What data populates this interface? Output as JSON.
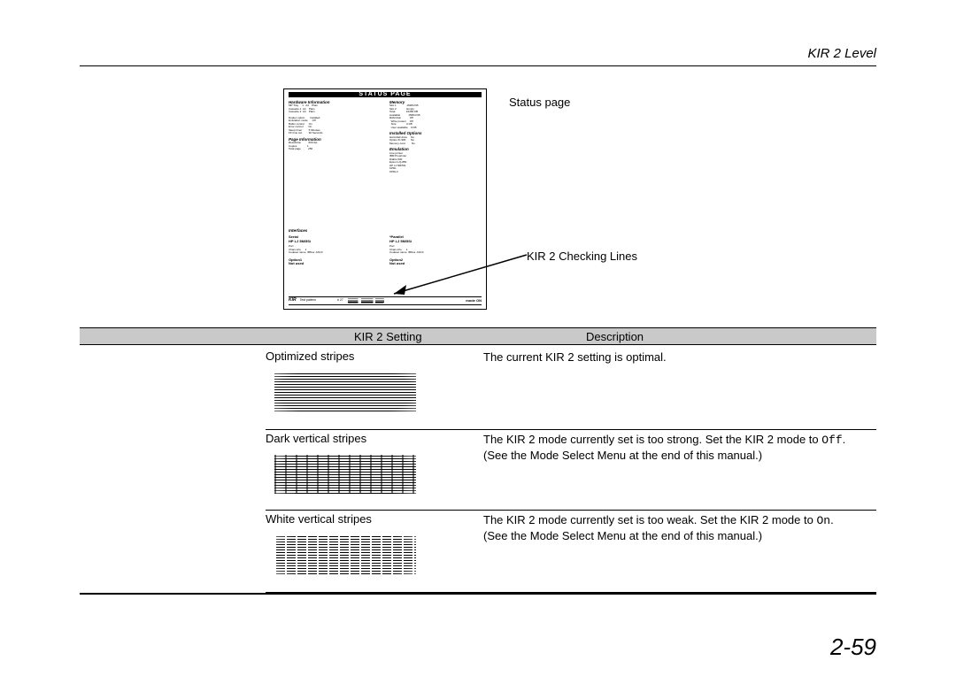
{
  "header": {
    "section_title": "KIR 2 Level"
  },
  "callouts": {
    "status_page": "Status page",
    "kir_check": "KIR 2 Checking Lines"
  },
  "status_thumb": {
    "title": "STATUS PAGE",
    "left": {
      "h1": "Hardware Information",
      "b1": "MP Tray     1   A4    Plain\nCassette 1  A4    Plain\nCassette 2  A4    Plain",
      "b2": "Duplex option       Installed\nEmulation mode      Off\nBuffer control      On\nError control       On\nSleep timer         5 Minutes\nFF time out         30 Seconds",
      "h2": "Page Information",
      "b3": "Resolution          600 dpi\nCopies              1\nTotal page          250",
      "h3": "Interfaces",
      "serial": "Serial",
      "serial2": "HP LJ 5M/5Si",
      "b4": "Port\nChars info.     1\nCodeset name  IBM-a  ASCII",
      "opt1a": "Option1",
      "opt1b": "Not used"
    },
    "right": {
      "h1": "Memory",
      "b1": "Slot 1              16384 KB\nSlot 2              Empty\nTotal               16384 KB\nAvailable           15954 KB\nRAM disk            Off\n  Write protect     Off\n  Size              0 KB\n  User available    0 KB",
      "h2": "Installed Options",
      "b2": "Hard disk drive     No\nOption IF-900       No\nMemory card         No",
      "h3": "Emulation",
      "b3": "Line printer\nIBM Proprinter\nDiablo 630\nEpson LQ-850\nHP LJ 5M/5Si\nKPDL\nKPDL3",
      "parallel": "*Parallel",
      "parallel2": "HP LJ 5M/5Si",
      "b4": "Port\nChars info.     1\nCodeset name  IBM-a  ASCII",
      "opt2a": "Option2",
      "opt2b": "Not used"
    },
    "kir": {
      "label": "KIR",
      "test": "Test pattern",
      "num": "# 27",
      "mode": "mode   ON"
    }
  },
  "table": {
    "head_setting": "KIR 2 Setting",
    "head_desc": "Description",
    "rows": [
      {
        "name": "Optimized stripes",
        "desc": "The current KIR 2 setting is optimal.",
        "desc2": ""
      },
      {
        "name": "Dark vertical stripes",
        "desc": "The KIR 2 mode currently set is too strong. Set the KIR 2 mode to ",
        "code": "Off",
        "desc_tail": ".",
        "desc2": "(See the Mode Select Menu at the end of this manual.)"
      },
      {
        "name": "White vertical stripes",
        "desc": "The KIR 2 mode currently set is too weak. Set the KIR 2 mode to ",
        "code": "On",
        "desc_tail": ".",
        "desc2": "(See the Mode Select Menu at the end of this manual.)"
      }
    ]
  },
  "page_number": "2-59"
}
